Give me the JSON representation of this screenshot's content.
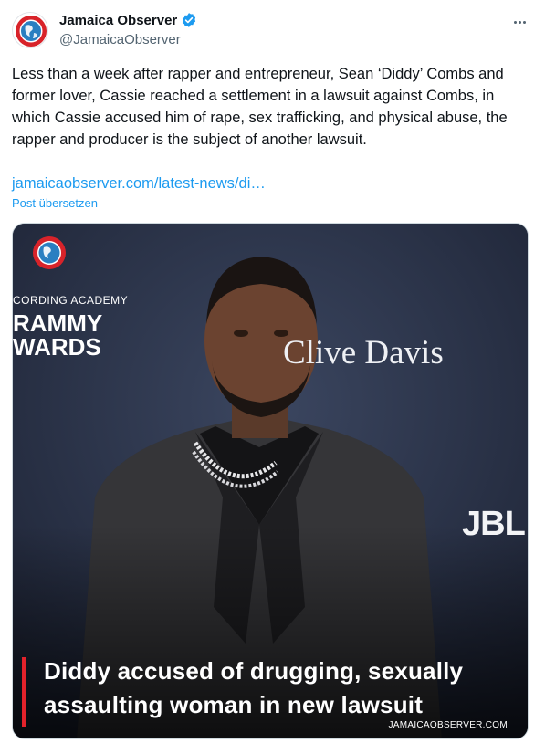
{
  "account": {
    "name": "Jamaica Observer",
    "handle": "@JamaicaObserver",
    "verified_icon": "verified-badge-icon",
    "avatar_icon": "globe-logo-icon"
  },
  "tweet": {
    "text": "Less than a week after rapper and entrepreneur, Sean ‘Diddy’ Combs and former lover, Cassie reached a settlement in a lawsuit against Combs, in which Cassie accused him of rape, sex trafficking, and physical abuse, the rapper and producer is the subject of another lawsuit.",
    "link": "jamaicaobserver.com/latest-news/di…",
    "translate": "Post übersetzen",
    "more_icon": "more-options-icon"
  },
  "media": {
    "headline": "Diddy accused of drugging, sexually assaulting woman in new lawsuit",
    "source": "JAMAICAOBSERVER.COM",
    "backdrop_line1": "CORDING ACADEMY",
    "backdrop_line2": "RAMMY",
    "backdrop_line3": "WARDS",
    "backdrop_clive": "Clive Davis",
    "backdrop_jbl": "JBL",
    "accent_color": "#e3222b"
  },
  "colors": {
    "link": "#1d9bf0",
    "secondary_text": "#536471",
    "verified": "#1d9bf0"
  }
}
